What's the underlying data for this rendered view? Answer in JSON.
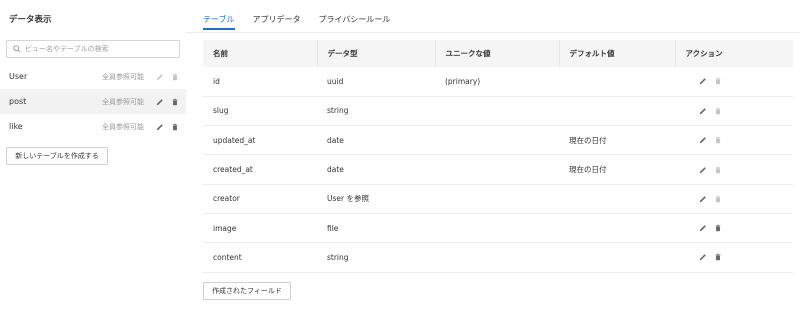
{
  "sidebar": {
    "title": "データ表示",
    "search": {
      "placeholder": "ビュー名やテーブルの検索",
      "value": ""
    },
    "items": [
      {
        "name": "User",
        "note": "全員参照可能",
        "edit_enabled": false,
        "delete_enabled": false,
        "active": false
      },
      {
        "name": "post",
        "note": "全員参照可能",
        "edit_enabled": true,
        "delete_enabled": true,
        "active": true
      },
      {
        "name": "like",
        "note": "全員参照可能",
        "edit_enabled": true,
        "delete_enabled": true,
        "active": false
      }
    ],
    "new_table_label": "新しいテーブルを作成する"
  },
  "tabs": [
    {
      "label": "テーブル",
      "active": true
    },
    {
      "label": "アプリデータ",
      "active": false
    },
    {
      "label": "プライバシールール",
      "active": false
    }
  ],
  "table": {
    "headers": [
      "名前",
      "データ型",
      "ユニークな値",
      "デフォルト値",
      "アクション"
    ],
    "rows": [
      {
        "name": "id",
        "type": "uuid",
        "unique": "(primary)",
        "default": "",
        "delete_enabled": false
      },
      {
        "name": "slug",
        "type": "string",
        "unique": "",
        "default": "",
        "delete_enabled": false
      },
      {
        "name": "updated_at",
        "type": "date",
        "unique": "",
        "default": "現在の日付",
        "delete_enabled": false
      },
      {
        "name": "created_at",
        "type": "date",
        "unique": "",
        "default": "現在の日付",
        "delete_enabled": false
      },
      {
        "name": "creator",
        "type": "User を参照",
        "unique": "",
        "default": "",
        "delete_enabled": false
      },
      {
        "name": "image",
        "type": "file",
        "unique": "",
        "default": "",
        "delete_enabled": true
      },
      {
        "name": "content",
        "type": "string",
        "unique": "",
        "default": "",
        "delete_enabled": true
      }
    ]
  },
  "created_fields_label": "作成されたフィールド",
  "colors": {
    "accent": "#1a73c8",
    "icon_enabled": "#666666",
    "icon_disabled": "#c4c4c4",
    "active_row": "#f2f2f2"
  },
  "icons": {
    "search": "search-icon",
    "edit": "pencil-icon",
    "delete": "trash-icon"
  }
}
